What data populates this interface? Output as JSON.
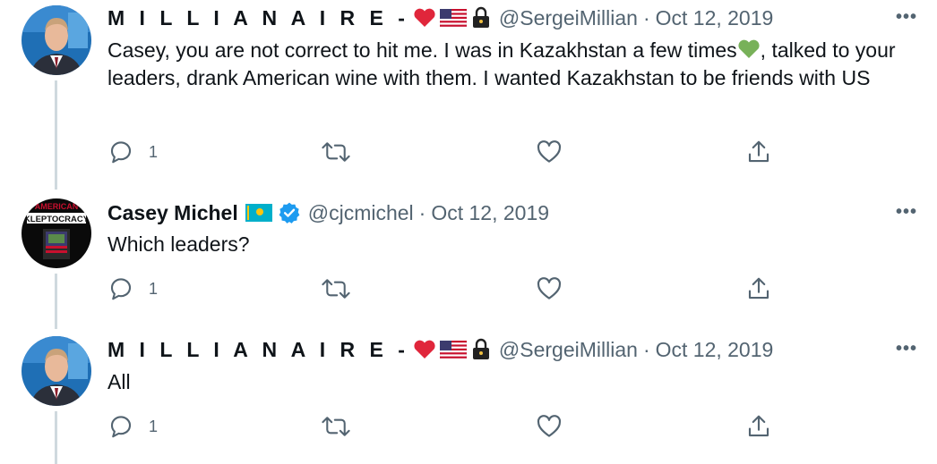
{
  "tweets": [
    {
      "display_name": "M I L L I A N A I R E -",
      "handle": "@SergeiMillian",
      "separator": "·",
      "date": "Oct 12, 2019",
      "text_parts": [
        "Casey, you are not correct to hit me. I was in Kazakhstan a few times",
        ", talked to your leaders, drank American wine with them. I wanted Kazakhstan to be friends with US"
      ],
      "reply_count": "1",
      "more": "•••",
      "icons": [
        "red-heart-icon",
        "us-flag-icon",
        "lock-icon",
        "green-heart-icon"
      ]
    },
    {
      "display_name": "Casey Michel",
      "handle": "@cjcmichel",
      "separator": "·",
      "date": "Oct 12, 2019",
      "text": "Which leaders?",
      "reply_count": "1",
      "more": "•••",
      "avatar_text": "KLEPTOCRACY",
      "avatar_top_text": "AMERICAN",
      "icons": [
        "kazakhstan-flag-icon",
        "verified-badge-icon"
      ]
    },
    {
      "display_name": "M I L L I A N A I R E -",
      "handle": "@SergeiMillian",
      "separator": "·",
      "date": "Oct 12, 2019",
      "text": "All",
      "reply_count": "1",
      "more": "•••",
      "icons": [
        "red-heart-icon",
        "us-flag-icon",
        "lock-icon"
      ]
    }
  ],
  "colors": {
    "text": "#0f1419",
    "muted": "#536471",
    "verified": "#1d9bf0",
    "thread_line": "#cfd9de",
    "red_heart": "#e0263b",
    "green_heart": "#78b159",
    "kz_flag": "#00afca"
  }
}
